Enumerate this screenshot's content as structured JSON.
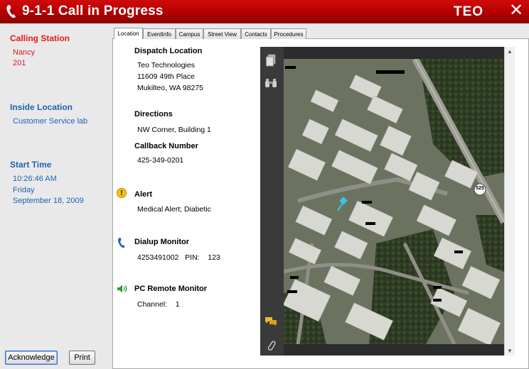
{
  "window": {
    "title": "9-1-1 Call in Progress",
    "brand": "TEO",
    "close": "✕"
  },
  "left": {
    "calling_station": {
      "heading": "Calling Station",
      "name": "Nancy",
      "number": "201"
    },
    "inside_location": {
      "heading": "Inside Location",
      "value": "Customer Service lab"
    },
    "start_time": {
      "heading": "Start Time",
      "time": "10:26:46 AM",
      "day": "Friday",
      "date": "September 18, 2009"
    },
    "buttons": {
      "acknowledge": "Acknowledge",
      "print": "Print"
    }
  },
  "tabs": [
    "Location",
    "EventInfo",
    "Campus",
    "Street View",
    "Contacts",
    "Procedures"
  ],
  "content": {
    "dispatch": {
      "heading": "Dispatch Location",
      "line1": "Teo Technologies",
      "line2": "11609 49th Place",
      "line3": "Mukilteo, WA 98275"
    },
    "directions": {
      "heading": "Directions",
      "value": "NW Corner, Building 1"
    },
    "callback": {
      "heading": "Callback Number",
      "value": "425-349-0201"
    },
    "alert": {
      "heading": "Alert",
      "value": "Medical Alert; Diabetic"
    },
    "dialup": {
      "heading": "Dialup Monitor",
      "value": "4253491002   PIN:    123"
    },
    "pc_remote": {
      "heading": "PC Remote Monitor",
      "value": "Channel:    1"
    }
  },
  "map": {
    "road_marker": "525"
  },
  "colors": {
    "accent_red": "#e31b1b",
    "link_blue": "#1e63b0",
    "title_bar": "#b30000"
  }
}
